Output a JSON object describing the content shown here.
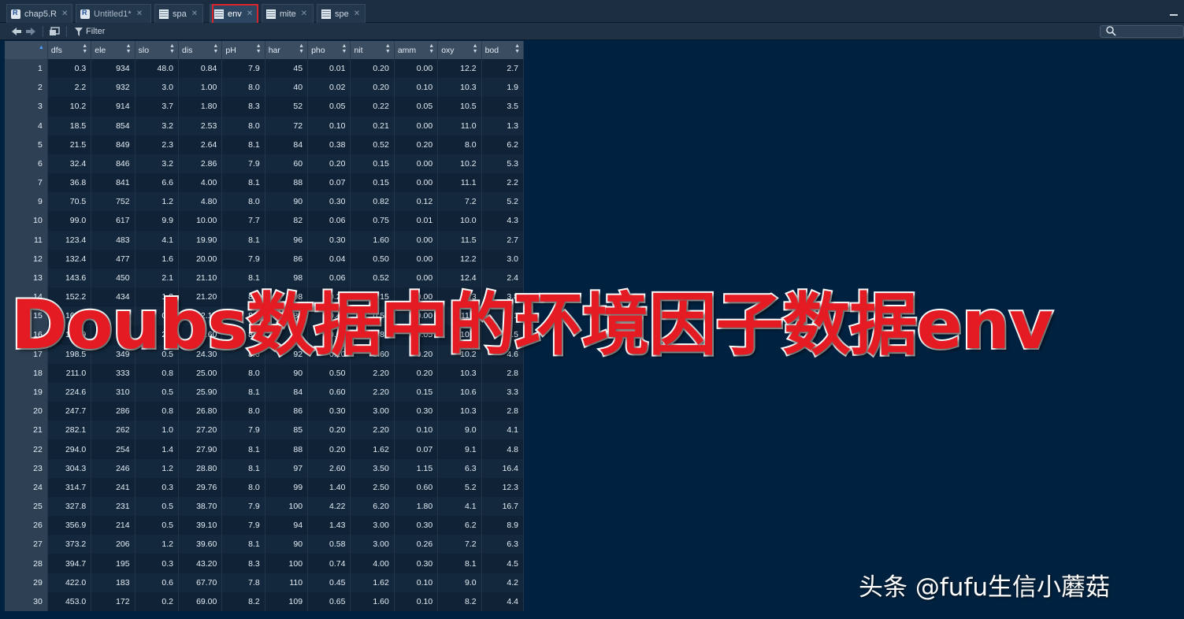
{
  "tabs": [
    {
      "label": "chap5.R",
      "icon": "r-script-icon"
    },
    {
      "label": "Untitled1*",
      "icon": "r-script-icon"
    },
    {
      "label": "spa",
      "icon": "table-icon"
    },
    {
      "label": "env",
      "icon": "table-icon"
    },
    {
      "label": "mite",
      "icon": "table-icon"
    },
    {
      "label": "spe",
      "icon": "table-icon"
    }
  ],
  "active_tab": "env",
  "toolbar": {
    "filter_label": "Filter"
  },
  "table": {
    "columns": [
      "dfs",
      "ele",
      "slo",
      "dis",
      "pH",
      "har",
      "pho",
      "nit",
      "amm",
      "oxy",
      "bod"
    ],
    "rows": [
      [
        "1",
        "0.3",
        "934",
        "48.0",
        "0.84",
        "7.9",
        "45",
        "0.01",
        "0.20",
        "0.00",
        "12.2",
        "2.7"
      ],
      [
        "2",
        "2.2",
        "932",
        "3.0",
        "1.00",
        "8.0",
        "40",
        "0.02",
        "0.20",
        "0.10",
        "10.3",
        "1.9"
      ],
      [
        "3",
        "10.2",
        "914",
        "3.7",
        "1.80",
        "8.3",
        "52",
        "0.05",
        "0.22",
        "0.05",
        "10.5",
        "3.5"
      ],
      [
        "4",
        "18.5",
        "854",
        "3.2",
        "2.53",
        "8.0",
        "72",
        "0.10",
        "0.21",
        "0.00",
        "11.0",
        "1.3"
      ],
      [
        "5",
        "21.5",
        "849",
        "2.3",
        "2.64",
        "8.1",
        "84",
        "0.38",
        "0.52",
        "0.20",
        "8.0",
        "6.2"
      ],
      [
        "6",
        "32.4",
        "846",
        "3.2",
        "2.86",
        "7.9",
        "60",
        "0.20",
        "0.15",
        "0.00",
        "10.2",
        "5.3"
      ],
      [
        "7",
        "36.8",
        "841",
        "6.6",
        "4.00",
        "8.1",
        "88",
        "0.07",
        "0.15",
        "0.00",
        "11.1",
        "2.2"
      ],
      [
        "9",
        "70.5",
        "752",
        "1.2",
        "4.80",
        "8.0",
        "90",
        "0.30",
        "0.82",
        "0.12",
        "7.2",
        "5.2"
      ],
      [
        "10",
        "99.0",
        "617",
        "9.9",
        "10.00",
        "7.7",
        "82",
        "0.06",
        "0.75",
        "0.01",
        "10.0",
        "4.3"
      ],
      [
        "11",
        "123.4",
        "483",
        "4.1",
        "19.90",
        "8.1",
        "96",
        "0.30",
        "1.60",
        "0.00",
        "11.5",
        "2.7"
      ],
      [
        "12",
        "132.4",
        "477",
        "1.6",
        "20.00",
        "7.9",
        "86",
        "0.04",
        "0.50",
        "0.00",
        "12.2",
        "3.0"
      ],
      [
        "13",
        "143.6",
        "450",
        "2.1",
        "21.10",
        "8.1",
        "98",
        "0.06",
        "0.52",
        "0.00",
        "12.4",
        "2.4"
      ],
      [
        "14",
        "152.2",
        "434",
        "1.2",
        "21.20",
        "8.3",
        "98",
        "0.27",
        "1.15",
        "0.00",
        "12.3",
        "3.8"
      ],
      [
        "15",
        "164.5",
        "415",
        "0.5",
        "22.10",
        "8.6",
        "86",
        "0.40",
        "0.54",
        "0.00",
        "11.3",
        "2.1"
      ],
      [
        "16",
        "185.9",
        "375",
        "2.0",
        "23.60",
        "8.0",
        "88",
        "0.20",
        "0.85",
        "0.05",
        "10.0",
        "2.5"
      ],
      [
        "17",
        "198.5",
        "349",
        "0.5",
        "24.30",
        "8.0",
        "92",
        "0.20",
        "1.60",
        "0.20",
        "10.2",
        "4.6"
      ],
      [
        "18",
        "211.0",
        "333",
        "0.8",
        "25.00",
        "8.0",
        "90",
        "0.50",
        "2.20",
        "0.20",
        "10.3",
        "2.8"
      ],
      [
        "19",
        "224.6",
        "310",
        "0.5",
        "25.90",
        "8.1",
        "84",
        "0.60",
        "2.20",
        "0.15",
        "10.6",
        "3.3"
      ],
      [
        "20",
        "247.7",
        "286",
        "0.8",
        "26.80",
        "8.0",
        "86",
        "0.30",
        "3.00",
        "0.30",
        "10.3",
        "2.8"
      ],
      [
        "21",
        "282.1",
        "262",
        "1.0",
        "27.20",
        "7.9",
        "85",
        "0.20",
        "2.20",
        "0.10",
        "9.0",
        "4.1"
      ],
      [
        "22",
        "294.0",
        "254",
        "1.4",
        "27.90",
        "8.1",
        "88",
        "0.20",
        "1.62",
        "0.07",
        "9.1",
        "4.8"
      ],
      [
        "23",
        "304.3",
        "246",
        "1.2",
        "28.80",
        "8.1",
        "97",
        "2.60",
        "3.50",
        "1.15",
        "6.3",
        "16.4"
      ],
      [
        "24",
        "314.7",
        "241",
        "0.3",
        "29.76",
        "8.0",
        "99",
        "1.40",
        "2.50",
        "0.60",
        "5.2",
        "12.3"
      ],
      [
        "25",
        "327.8",
        "231",
        "0.5",
        "38.70",
        "7.9",
        "100",
        "4.22",
        "6.20",
        "1.80",
        "4.1",
        "16.7"
      ],
      [
        "26",
        "356.9",
        "214",
        "0.5",
        "39.10",
        "7.9",
        "94",
        "1.43",
        "3.00",
        "0.30",
        "6.2",
        "8.9"
      ],
      [
        "27",
        "373.2",
        "206",
        "1.2",
        "39.60",
        "8.1",
        "90",
        "0.58",
        "3.00",
        "0.26",
        "7.2",
        "6.3"
      ],
      [
        "28",
        "394.7",
        "195",
        "0.3",
        "43.20",
        "8.3",
        "100",
        "0.74",
        "4.00",
        "0.30",
        "8.1",
        "4.5"
      ],
      [
        "29",
        "422.0",
        "183",
        "0.6",
        "67.70",
        "7.8",
        "110",
        "0.45",
        "1.62",
        "0.10",
        "9.0",
        "4.2"
      ],
      [
        "30",
        "453.0",
        "172",
        "0.2",
        "69.00",
        "8.2",
        "109",
        "0.65",
        "1.60",
        "0.10",
        "8.2",
        "4.4"
      ]
    ]
  },
  "overlay": {
    "headline": "Doubs数据中的环境因子数据env",
    "watermark": "头条 @fufu生信小蘑菇"
  },
  "colors": {
    "background": "#002240",
    "headline": "#e51b24",
    "active_tab_highlight": "#d8242b"
  }
}
